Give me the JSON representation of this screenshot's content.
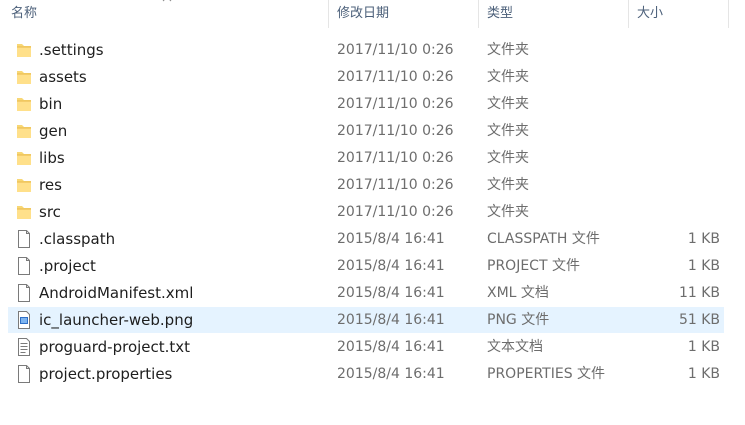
{
  "header": {
    "name": "名称",
    "date": "修改日期",
    "type": "类型",
    "size": "大小"
  },
  "files": [
    {
      "name": ".settings",
      "date": "2017/11/10 0:26",
      "type": "文件夹",
      "size": "",
      "icon": "folder-icon"
    },
    {
      "name": "assets",
      "date": "2017/11/10 0:26",
      "type": "文件夹",
      "size": "",
      "icon": "folder-icon"
    },
    {
      "name": "bin",
      "date": "2017/11/10 0:26",
      "type": "文件夹",
      "size": "",
      "icon": "folder-icon"
    },
    {
      "name": "gen",
      "date": "2017/11/10 0:26",
      "type": "文件夹",
      "size": "",
      "icon": "folder-icon"
    },
    {
      "name": "libs",
      "date": "2017/11/10 0:26",
      "type": "文件夹",
      "size": "",
      "icon": "folder-icon"
    },
    {
      "name": "res",
      "date": "2017/11/10 0:26",
      "type": "文件夹",
      "size": "",
      "icon": "folder-icon"
    },
    {
      "name": "src",
      "date": "2017/11/10 0:26",
      "type": "文件夹",
      "size": "",
      "icon": "folder-icon"
    },
    {
      "name": ".classpath",
      "date": "2015/8/4 16:41",
      "type": "CLASSPATH 文件",
      "size": "1 KB",
      "icon": "file-icon"
    },
    {
      "name": ".project",
      "date": "2015/8/4 16:41",
      "type": "PROJECT 文件",
      "size": "1 KB",
      "icon": "file-icon"
    },
    {
      "name": "AndroidManifest.xml",
      "date": "2015/8/4 16:41",
      "type": "XML 文档",
      "size": "11 KB",
      "icon": "file-icon"
    },
    {
      "name": "ic_launcher-web.png",
      "date": "2015/8/4 16:41",
      "type": "PNG 文件",
      "size": "51 KB",
      "icon": "image-file-icon",
      "selected": true
    },
    {
      "name": "proguard-project.txt",
      "date": "2015/8/4 16:41",
      "type": "文本文档",
      "size": "1 KB",
      "icon": "text-file-icon"
    },
    {
      "name": "project.properties",
      "date": "2015/8/4 16:41",
      "type": "PROPERTIES 文件",
      "size": "1 KB",
      "icon": "file-icon"
    }
  ],
  "colors": {
    "header_text": "#4c607a",
    "selected_row": "#e5f3ff",
    "folder": "#f8d775",
    "secondary_text": "#6d6d6d"
  }
}
